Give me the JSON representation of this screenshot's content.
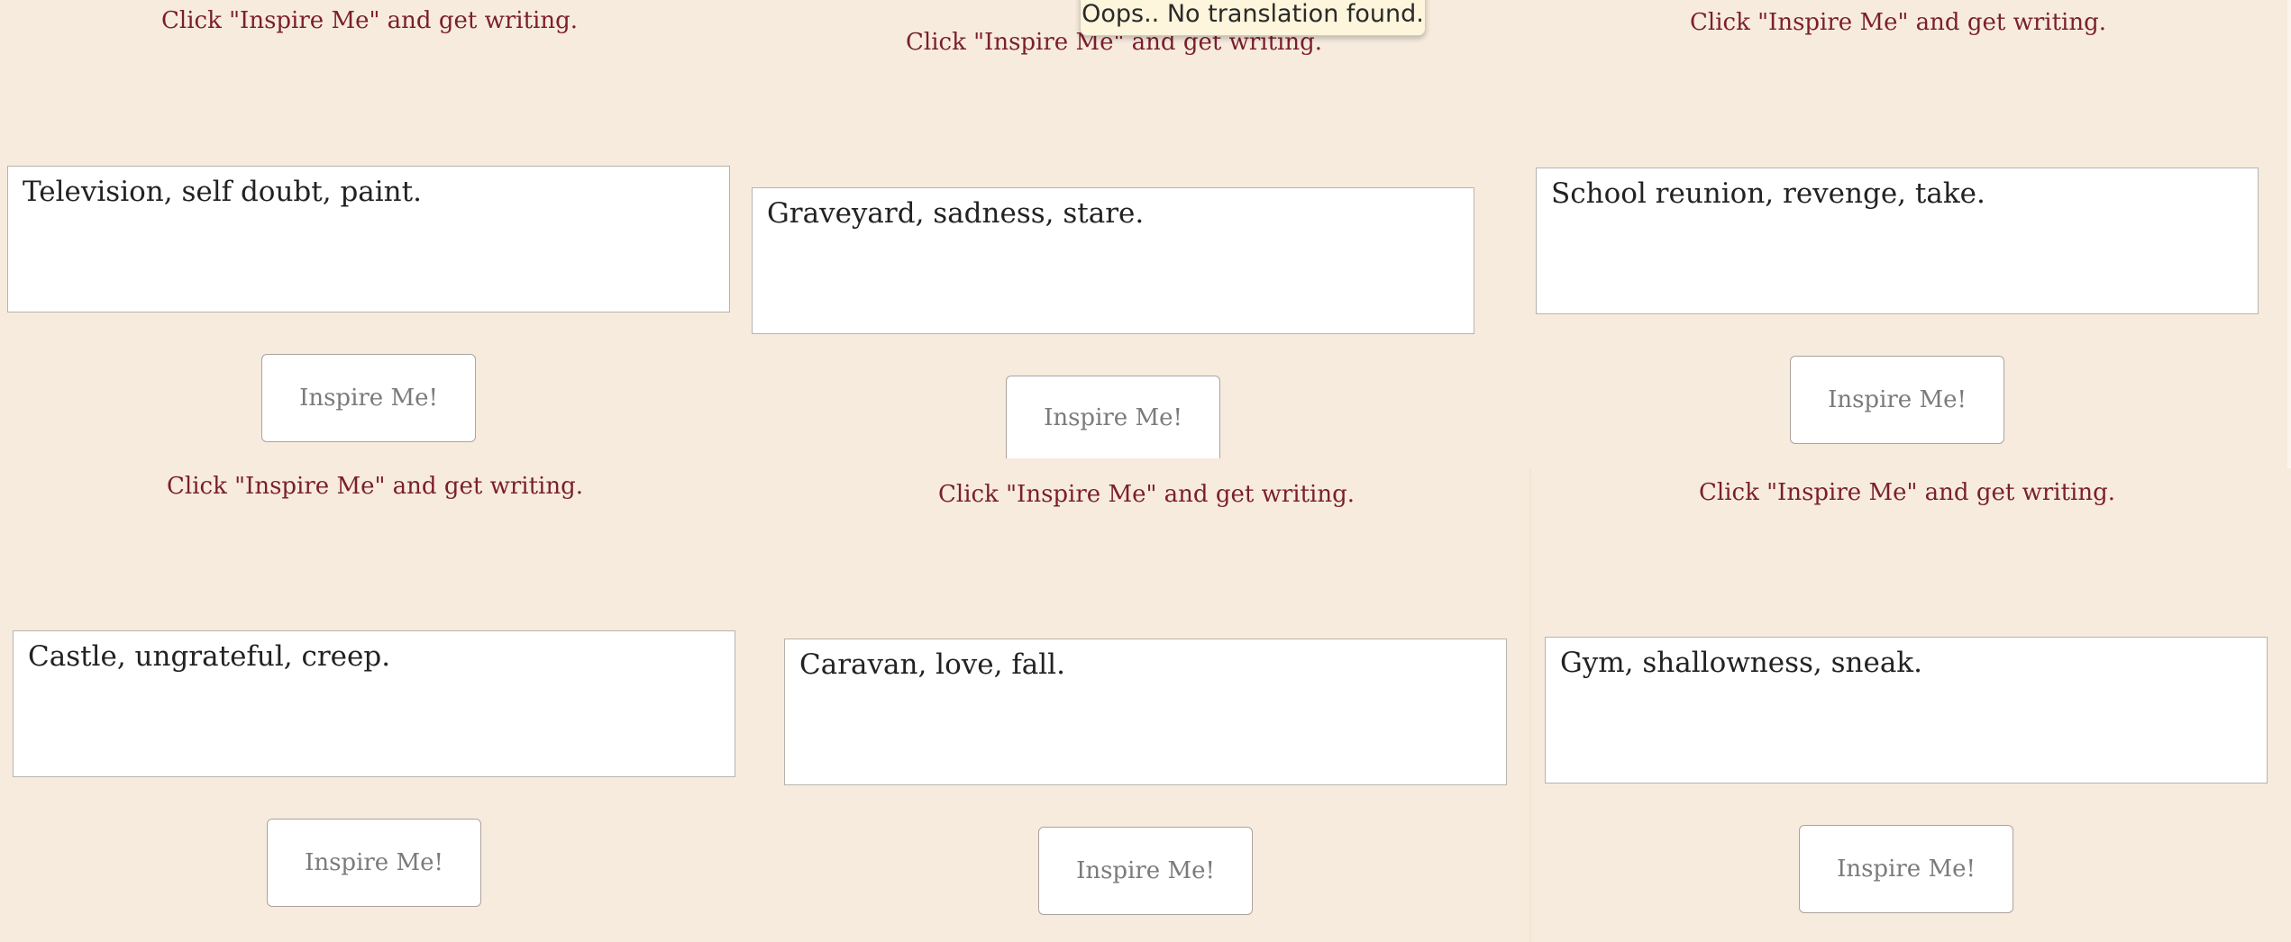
{
  "hint_text": "Click \"Inspire Me\" and get writing.",
  "button_label": "Inspire Me!",
  "tooltip_text": "Oops.. No translation found.",
  "prompts": [
    "Television, self doubt, paint.",
    "Graveyard, sadness, stare.",
    "School reunion, revenge, take.",
    "Castle, ungrateful, creep.",
    "Caravan, love, fall.",
    "Gym, shallowness, sneak."
  ],
  "colors": {
    "background": "#f7ebde",
    "hint_text": "#7a1f2b",
    "tooltip_bg": "#fdf5dc"
  }
}
